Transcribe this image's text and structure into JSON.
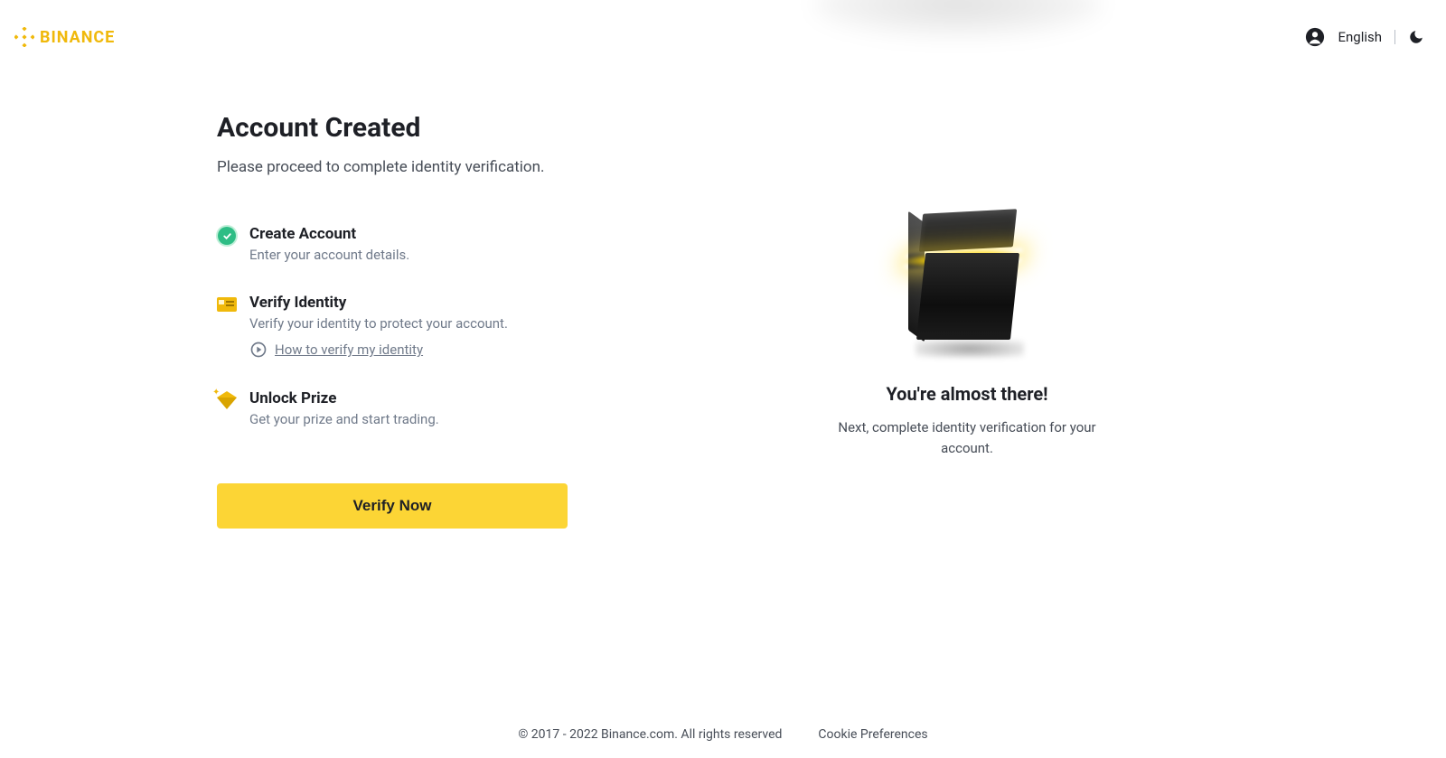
{
  "brand": {
    "name": "BINANCE"
  },
  "header": {
    "language": "English"
  },
  "page": {
    "title": "Account Created",
    "subtitle": "Please proceed to complete identity verification."
  },
  "steps": {
    "create": {
      "title": "Create Account",
      "desc": "Enter your account details."
    },
    "verify": {
      "title": "Verify Identity",
      "desc": "Verify your identity to protect your account.",
      "help_link": "How to verify my identity"
    },
    "unlock": {
      "title": "Unlock Prize",
      "desc": "Get your prize and start trading."
    }
  },
  "cta": {
    "label": "Verify Now"
  },
  "promo": {
    "title": "You're almost there!",
    "desc": "Next, complete identity verification for your account."
  },
  "footer": {
    "copyright": "© 2017 - 2022 Binance.com. All rights reserved",
    "cookie": "Cookie Preferences"
  }
}
